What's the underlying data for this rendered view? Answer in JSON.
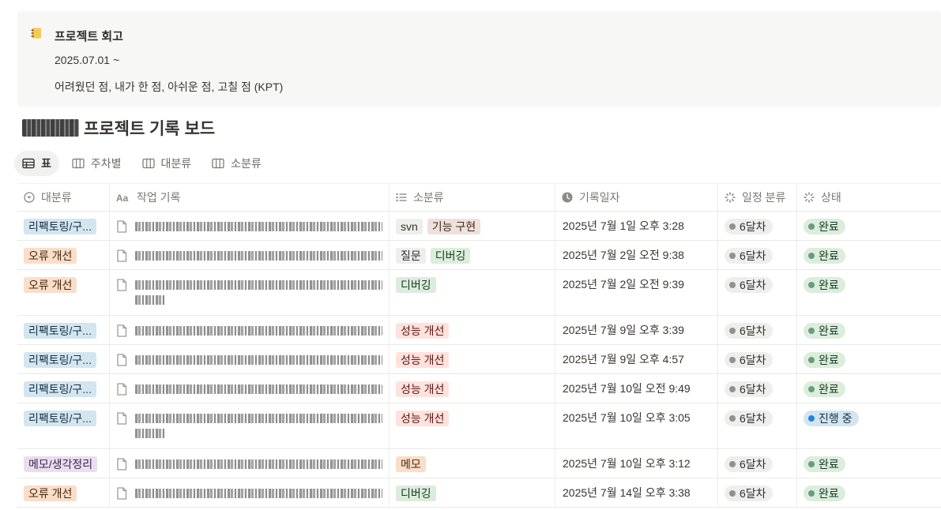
{
  "callout": {
    "icon": "notebook-icon",
    "title": "프로젝트 회고",
    "date": "2025.07.01 ~",
    "description": "어려웠던 점, 내가 한 점, 아쉬운 점, 고칠 점 (KPT)"
  },
  "board": {
    "title_suffix": "프로젝트 기록 보드"
  },
  "views": [
    {
      "label": "표",
      "icon": "table-icon",
      "active": true
    },
    {
      "label": "주차별",
      "icon": "board-icon",
      "active": false
    },
    {
      "label": "대분류",
      "icon": "board-icon",
      "active": false
    },
    {
      "label": "소분류",
      "icon": "board-icon",
      "active": false
    }
  ],
  "columns": [
    {
      "label": "대분류",
      "icon": "select-icon"
    },
    {
      "label": "작업 기록",
      "icon": "title-aa-icon"
    },
    {
      "label": "소분류",
      "icon": "list-icon"
    },
    {
      "label": "기록일자",
      "icon": "clock-icon"
    },
    {
      "label": "일정 분류",
      "icon": "status-icon"
    },
    {
      "label": "상태",
      "icon": "status-icon"
    }
  ],
  "rows": [
    {
      "category": "리팩토링/구...",
      "category_color": "blue",
      "lines": 1,
      "tags": [
        {
          "label": "svn",
          "color": "gray"
        },
        {
          "label": "기능 구현",
          "color": "brown"
        }
      ],
      "date": "2025년 7월 1일 오후 3:28",
      "schedule": "6달차",
      "status": "완료",
      "status_color": "green"
    },
    {
      "category": "오류 개선",
      "category_color": "orange",
      "lines": 1,
      "tags": [
        {
          "label": "질문",
          "color": "gray"
        },
        {
          "label": "디버깅",
          "color": "green"
        }
      ],
      "date": "2025년 7월 2일 오전 9:38",
      "schedule": "6달차",
      "status": "완료",
      "status_color": "green"
    },
    {
      "category": "오류 개선",
      "category_color": "orange",
      "lines": 2,
      "tags": [
        {
          "label": "디버깅",
          "color": "green"
        }
      ],
      "date": "2025년 7월 2일 오전 9:39",
      "schedule": "6달차",
      "status": "완료",
      "status_color": "green"
    },
    {
      "category": "리팩토링/구...",
      "category_color": "blue",
      "lines": 1,
      "tags": [
        {
          "label": "성능 개선",
          "color": "red"
        }
      ],
      "date": "2025년 7월 9일 오후 3:39",
      "schedule": "6달차",
      "status": "완료",
      "status_color": "green"
    },
    {
      "category": "리팩토링/구...",
      "category_color": "blue",
      "lines": 1,
      "tags": [
        {
          "label": "성능 개선",
          "color": "red"
        }
      ],
      "date": "2025년 7월 9일 오후 4:57",
      "schedule": "6달차",
      "status": "완료",
      "status_color": "green"
    },
    {
      "category": "리팩토링/구...",
      "category_color": "blue",
      "lines": 1,
      "tags": [
        {
          "label": "성능 개선",
          "color": "red"
        }
      ],
      "date": "2025년 7월 10일 오전 9:49",
      "schedule": "6달차",
      "status": "완료",
      "status_color": "green"
    },
    {
      "category": "리팩토링/구...",
      "category_color": "blue",
      "lines": 2,
      "tags": [
        {
          "label": "성능 개선",
          "color": "red"
        }
      ],
      "date": "2025년 7월 10일 오후 3:05",
      "schedule": "6달차",
      "status": "진행 중",
      "status_color": "blue"
    },
    {
      "category": "메모/생각정리",
      "category_color": "purple",
      "lines": 1,
      "tags": [
        {
          "label": "메모",
          "color": "orange"
        }
      ],
      "date": "2025년 7월 10일 오후 3:12",
      "schedule": "6달차",
      "status": "완료",
      "status_color": "green"
    },
    {
      "category": "오류 개선",
      "category_color": "orange",
      "lines": 1,
      "tags": [
        {
          "label": "디버깅",
          "color": "green"
        }
      ],
      "date": "2025년 7월 14일 오후 3:38",
      "schedule": "6달차",
      "status": "완료",
      "status_color": "green"
    }
  ]
}
